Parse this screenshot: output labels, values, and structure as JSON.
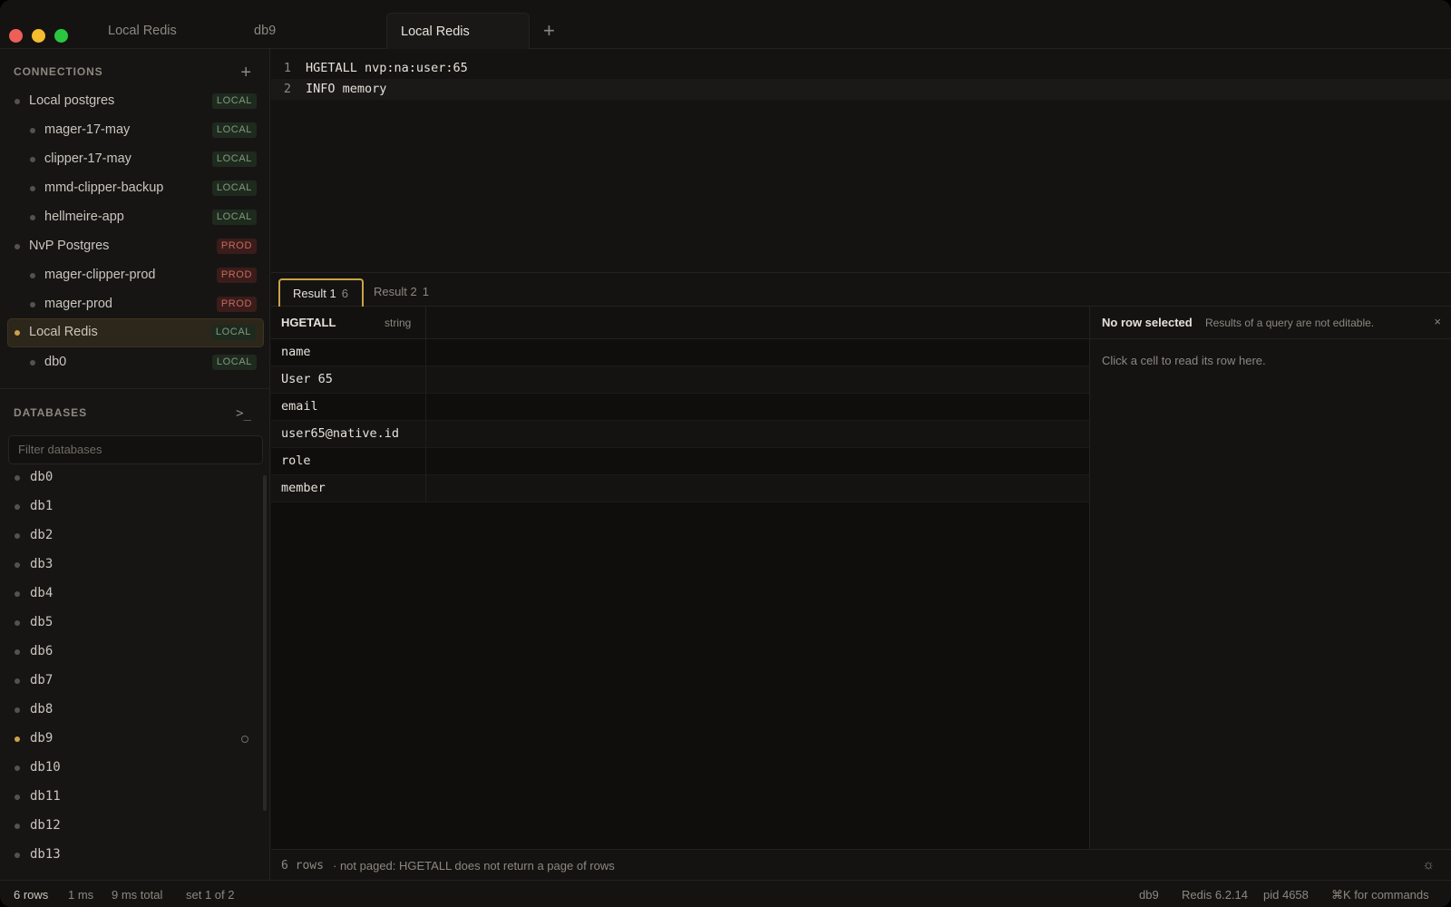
{
  "tabs": [
    {
      "label": "Local Redis"
    },
    {
      "label": "db9"
    },
    {
      "label": "Local Redis"
    }
  ],
  "sidebar": {
    "connections_title": "CONNECTIONS",
    "connections": [
      {
        "label": "Local postgres",
        "badge": "LOCAL"
      },
      {
        "label": "mager-17-may",
        "badge": "LOCAL"
      },
      {
        "label": "clipper-17-may",
        "badge": "LOCAL"
      },
      {
        "label": "mmd-clipper-backup",
        "badge": "LOCAL"
      },
      {
        "label": "hellmeire-app",
        "badge": "LOCAL"
      },
      {
        "label": "NvP Postgres",
        "badge": "PROD"
      },
      {
        "label": "mager-clipper-prod",
        "badge": "PROD"
      },
      {
        "label": "mager-prod",
        "badge": "PROD"
      },
      {
        "label": "Local Redis",
        "badge": "LOCAL"
      },
      {
        "label": "db0",
        "badge": "LOCAL"
      }
    ],
    "databases_title": "DATABASES",
    "terminal_icon": ">_",
    "filter_placeholder": "Filter databases",
    "databases": [
      "db0",
      "db1",
      "db2",
      "db3",
      "db4",
      "db5",
      "db6",
      "db7",
      "db8",
      "db9",
      "db10",
      "db11",
      "db12",
      "db13"
    ]
  },
  "editor": {
    "lines": [
      {
        "num": "1",
        "code": "HGETALL nvp:na:user:65"
      },
      {
        "num": "2",
        "code": "INFO memory"
      }
    ]
  },
  "results": {
    "tabs": [
      {
        "label": "Result 1",
        "count": "6"
      },
      {
        "label": "Result 2",
        "count": "1"
      }
    ],
    "column": {
      "name": "HGETALL",
      "type": "string"
    },
    "rows": [
      "name",
      "User 65",
      "email",
      "user65@native.id",
      "role",
      "member"
    ]
  },
  "detail": {
    "title": "No row selected",
    "subtitle": "Results of a query are not editable.",
    "close": "×",
    "hint": "Click a cell to read its row here."
  },
  "result_footer": {
    "rows": "6 rows",
    "note": "· not paged: HGETALL does not return a page of rows"
  },
  "statusbar": {
    "rows": "6 rows",
    "time": "1 ms",
    "total": "9 ms total",
    "set": "set 1 of 2",
    "db": "db9",
    "version": "Redis 6.2.14",
    "pid": "pid 4658",
    "commands": "⌘K for commands"
  },
  "colors": {
    "accent": "#c9a24a",
    "local_badge": "#7f9a7c",
    "prod_badge": "#c46a5f"
  }
}
